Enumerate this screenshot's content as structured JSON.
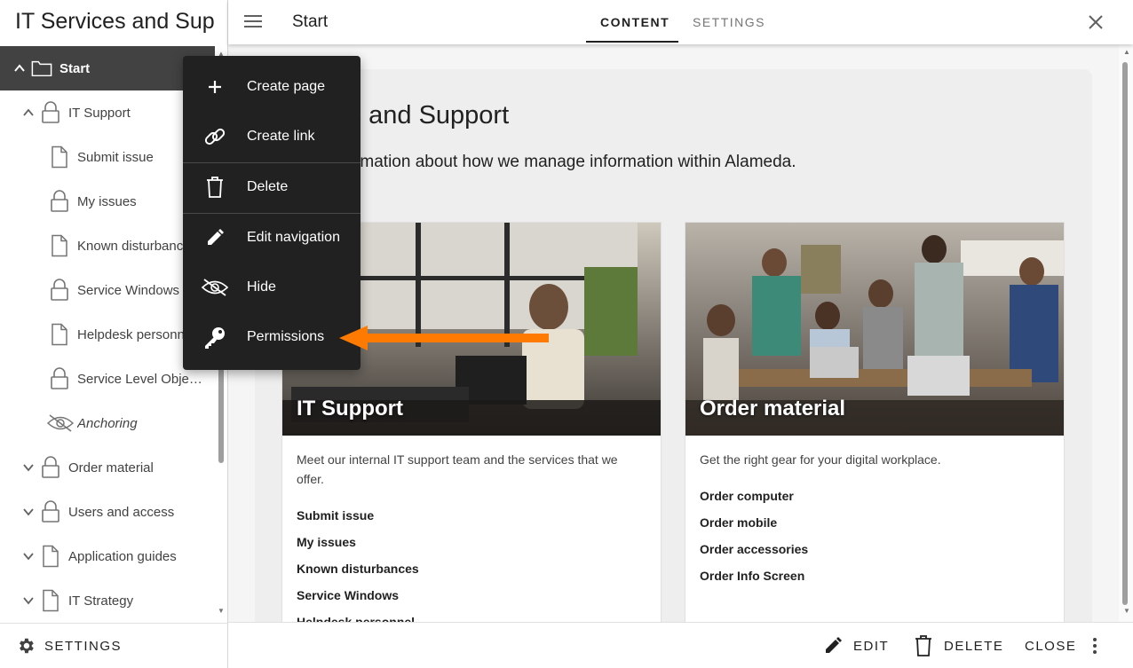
{
  "sidebar": {
    "title": "IT Services and Sup",
    "items": [
      {
        "label": "Start",
        "icon": "folder-icon",
        "chevron": "up"
      },
      {
        "label": "IT Support",
        "icon": "lock-icon",
        "chevron": "up"
      },
      {
        "label": "Submit issue",
        "icon": "page-icon"
      },
      {
        "label": "My issues",
        "icon": "lock-icon"
      },
      {
        "label": "Known disturbanc…",
        "icon": "page-icon"
      },
      {
        "label": "Service Windows",
        "icon": "lock-icon"
      },
      {
        "label": "Helpdesk personne…",
        "icon": "page-icon"
      },
      {
        "label": "Service Level Obje…",
        "icon": "lock-icon"
      },
      {
        "label": "Anchoring",
        "icon": "hidden-eye-icon"
      },
      {
        "label": "Order material",
        "icon": "lock-icon",
        "chevron": "down"
      },
      {
        "label": "Users and access",
        "icon": "lock-icon",
        "chevron": "down"
      },
      {
        "label": "Application guides",
        "icon": "page-icon",
        "chevron": "down"
      },
      {
        "label": "IT Strategy",
        "icon": "page-icon",
        "chevron": "down"
      }
    ],
    "settings_label": "SETTINGS"
  },
  "header": {
    "page_name": "Start",
    "tabs": [
      {
        "label": "CONTENT",
        "active": true
      },
      {
        "label": "SETTINGS",
        "active": false
      }
    ]
  },
  "content": {
    "heading": "vices and Support",
    "intro": "for information about how we manage information within Alameda.",
    "cards": [
      {
        "title": "IT Support",
        "description": "Meet our internal IT support team and the services that we offer.",
        "links": [
          "Submit issue",
          "My issues",
          "Known disturbances",
          "Service Windows",
          "Helpdesk personnel"
        ]
      },
      {
        "title": "Order material",
        "description": "Get the right gear for your digital workplace.",
        "links": [
          "Order computer",
          "Order mobile",
          "Order accessories",
          "Order Info Screen"
        ]
      }
    ]
  },
  "context_menu": {
    "items": [
      {
        "label": "Create page",
        "icon": "plus-icon"
      },
      {
        "label": "Create link",
        "icon": "link-icon"
      },
      {
        "label": "Delete",
        "icon": "trash-icon"
      },
      {
        "label": "Edit navigation",
        "icon": "pencil-icon"
      },
      {
        "label": "Hide",
        "icon": "hidden-eye-icon"
      },
      {
        "label": "Permissions",
        "icon": "key-icon"
      }
    ]
  },
  "bottombar": {
    "edit_label": "EDIT",
    "delete_label": "DELETE",
    "close_label": "CLOSE"
  },
  "colors": {
    "selected_bg": "#424242",
    "menu_bg": "#212121",
    "annotation_arrow": "#ff7a00"
  }
}
